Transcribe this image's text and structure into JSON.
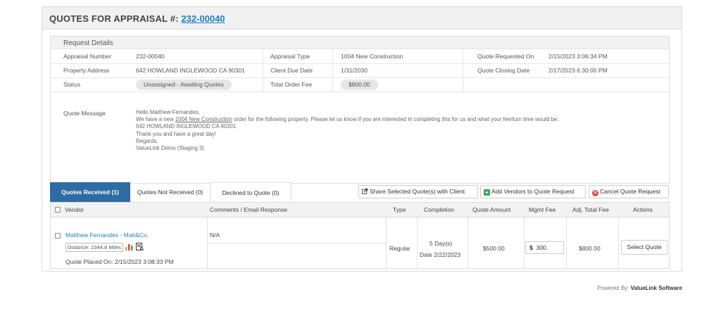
{
  "header": {
    "title_label": "QUOTES FOR APPRAISAL #:",
    "appraisal_link": "232-00040"
  },
  "details": {
    "section_title": "Request Details",
    "rows": [
      [
        {
          "label": "Appraisal Number",
          "value": "232-00040"
        },
        {
          "label": "Appraisal Type",
          "value": "1004 New Construction"
        },
        {
          "label": "Quote Requested On",
          "value": "2/15/2023 3:06:34 PM"
        }
      ],
      [
        {
          "label": "Property Address",
          "value": "642 HOWLAND INGLEWOOD CA 90301"
        },
        {
          "label": "Client Due Date",
          "value": "1/31/2030"
        },
        {
          "label": "Quote Closing Date",
          "value": "2/17/2023 6:30:00 PM"
        }
      ],
      [
        {
          "label": "Status",
          "value": "Unassigned - Awaiting Quotes"
        },
        {
          "label": "Total Order Fee",
          "value": "$800.00"
        },
        {
          "label": "",
          "value": ""
        }
      ]
    ],
    "quote_message_label": "Quote Message",
    "quote_message": {
      "line1": "Hello Matthew Fernandes,",
      "line2_pre": "We have a new ",
      "line2_link": "1004 New Construction",
      "line2_post": " order for the following property.  Please let us know if you are interested in completing this for us and what your fee/turn time would be.",
      "line3": "642 HOWLAND INGLEWOOD CA 90301",
      "line4": "Thank you and have a great day!",
      "line5": "Regards,",
      "line6": "ValueLink Demo (Staging 3)"
    }
  },
  "tabs": {
    "received": "Quotes Received (1)",
    "not_received": "Quotes Not Received (0)",
    "declined": "Declined to Quote (0)"
  },
  "actions": {
    "share": "Share Selected Quote(s) with Client",
    "add_vendors": "Add Vendors to Quote Request",
    "cancel": "Cancel Quote Request"
  },
  "table": {
    "headers": {
      "vendor": "Vendor",
      "comments": "Comments / Email Response",
      "type": "Type",
      "completion": "Completion",
      "quote_amount": "Quote Amount",
      "mgmt_fee": "Mgmt Fee",
      "adj_total": "Adj. Total Fee",
      "actions": "Actions"
    },
    "row": {
      "vendor_name": "Matthew Fernandes - Matt&Co.",
      "distance": "Distance: 2344.8 Miles",
      "placed_on": "Quote Placed On: 2/15/2023 3:08:33 PM",
      "comments": "N/A",
      "type": "Regular",
      "completion_days": "5 Day(s)",
      "completion_date": "Date 2/22/2023",
      "quote_amount": "$500.00",
      "mgmt_currency": "$",
      "mgmt_fee": "300.",
      "adj_total": "$800.00",
      "select_button": "Select Quote"
    }
  },
  "footer": {
    "powered_prefix": "Powered By:",
    "powered_brand": "ValueLink Software"
  },
  "colors": {
    "accent": "#2e6da4",
    "link": "#1b7fc1",
    "add_icon": "#3aa757",
    "cancel_icon": "#d9423a"
  }
}
